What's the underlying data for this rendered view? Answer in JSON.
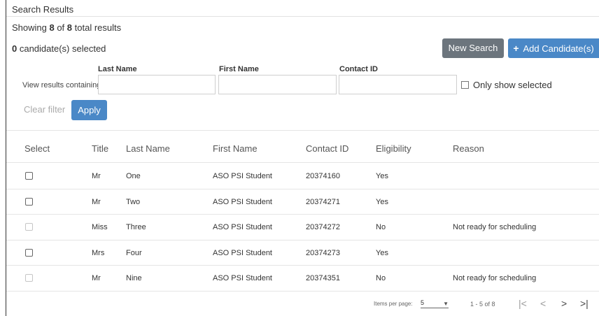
{
  "panel": {
    "title": "Search Results"
  },
  "summary": {
    "showing_prefix": "Showing ",
    "shown": "8",
    "of_text": " of ",
    "total": "8",
    "suffix": " total results"
  },
  "selection": {
    "count": "0",
    "label": " candidate(s) selected"
  },
  "buttons": {
    "new_search": "New Search",
    "add_candidate_icon": "+",
    "add_candidate": "Add Candidate(s)"
  },
  "filters": {
    "view_label": "View results containing",
    "last_name_label": "Last Name",
    "first_name_label": "First Name",
    "contact_id_label": "Contact ID",
    "last_name_value": "",
    "first_name_value": "",
    "contact_id_value": "",
    "only_selected_label": "Only show selected",
    "only_selected_checked": false,
    "clear_label": "Clear filter",
    "apply_label": "Apply"
  },
  "table": {
    "headers": [
      "Select",
      "Title",
      "Last Name",
      "First Name",
      "Contact ID",
      "Eligibility",
      "Reason"
    ],
    "rows": [
      {
        "title": "Mr",
        "last": "One",
        "first": "ASO PSI Student",
        "contact_id": "20374160",
        "eligibility": "Yes",
        "reason": "",
        "selectable": true
      },
      {
        "title": "Mr",
        "last": "Two",
        "first": "ASO PSI Student",
        "contact_id": "20374271",
        "eligibility": "Yes",
        "reason": "",
        "selectable": true
      },
      {
        "title": "Miss",
        "last": "Three",
        "first": "ASO PSI Student",
        "contact_id": "20374272",
        "eligibility": "No",
        "reason": "Not ready for scheduling",
        "selectable": false
      },
      {
        "title": "Mrs",
        "last": "Four",
        "first": "ASO PSI Student",
        "contact_id": "20374273",
        "eligibility": "Yes",
        "reason": "",
        "selectable": true
      },
      {
        "title": "Mr",
        "last": "Nine",
        "first": "ASO PSI Student",
        "contact_id": "20374351",
        "eligibility": "No",
        "reason": "Not ready for scheduling",
        "selectable": false
      }
    ]
  },
  "pager": {
    "items_label": "Items per page:",
    "items_value": "5",
    "range": "1 - 5 of 8",
    "first_icon": "|<",
    "prev_icon": "<",
    "next_icon": ">",
    "last_icon": ">|"
  }
}
